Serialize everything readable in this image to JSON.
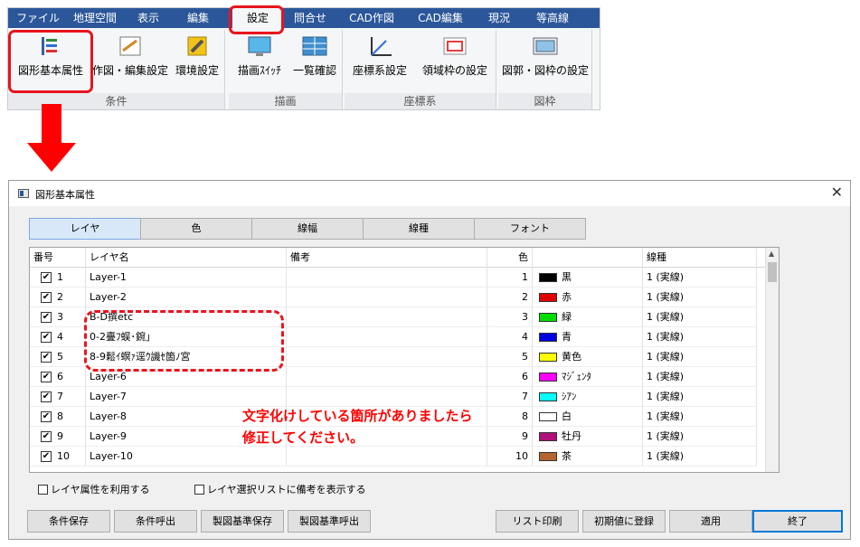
{
  "ribbon": {
    "menu": [
      "ファイル",
      "地理空間",
      "表示",
      "編集",
      "設定",
      "問合せ",
      "CAD作図",
      "CAD編集",
      "現況",
      "等高線"
    ],
    "groups": [
      {
        "label": "条件",
        "buttons": [
          "図形基本属性",
          "作図・編集設定",
          "環境設定"
        ]
      },
      {
        "label": "描画",
        "buttons": [
          "描画ｽｲｯﾁ",
          "一覧確認"
        ]
      },
      {
        "label": "座標系",
        "buttons": [
          "座標系設定",
          "領域枠の設定"
        ]
      },
      {
        "label": "図枠",
        "buttons": [
          "図郭・図枠の設定"
        ]
      }
    ]
  },
  "dialog": {
    "title": "図形基本属性",
    "tabs": [
      "レイヤ",
      "色",
      "線幅",
      "線種",
      "フォント"
    ],
    "columns": [
      "番号",
      "レイヤ名",
      "備考",
      "色",
      "",
      "線種"
    ],
    "rows": [
      {
        "num": "1",
        "name": "Layer-1",
        "note": "",
        "color": "1",
        "color_name": "黒",
        "swatch": "#000000",
        "line": "1 (実線)"
      },
      {
        "num": "2",
        "name": "Layer-2",
        "note": "",
        "color": "2",
        "color_name": "赤",
        "swatch": "#e00000",
        "line": "1 (実線)"
      },
      {
        "num": "3",
        "name": "B-D撰etc",
        "note": "",
        "color": "3",
        "color_name": "緑",
        "swatch": "#00dd00",
        "line": "1 (実線)"
      },
      {
        "num": "4",
        "name": "0-2亹ﾌ蜈･鋺｣",
        "note": "",
        "color": "4",
        "color_name": "青",
        "swatch": "#0000e0",
        "line": "1 (実線)"
      },
      {
        "num": "5",
        "name": "8-9鬆ｲ螟ｧ逕ｳ譏ｾ箇ﾉ宮",
        "note": "",
        "color": "5",
        "color_name": "黄色",
        "swatch": "#ffff00",
        "line": "1 (実線)"
      },
      {
        "num": "6",
        "name": "Layer-6",
        "note": "",
        "color": "6",
        "color_name": "ﾏｼﾞｪﾝﾀ",
        "swatch": "#ff00ff",
        "line": "1 (実線)"
      },
      {
        "num": "7",
        "name": "Layer-7",
        "note": "",
        "color": "7",
        "color_name": "ｼｱﾝ",
        "swatch": "#00ffff",
        "line": "1 (実線)"
      },
      {
        "num": "8",
        "name": "Layer-8",
        "note": "",
        "color": "8",
        "color_name": "白",
        "swatch": "#ffffff",
        "line": "1 (実線)"
      },
      {
        "num": "9",
        "name": "Layer-9",
        "note": "",
        "color": "9",
        "color_name": "牡丹",
        "swatch": "#b0107a",
        "line": "1 (実線)"
      },
      {
        "num": "10",
        "name": "Layer-10",
        "note": "",
        "color": "10",
        "color_name": "茶",
        "swatch": "#b5662e",
        "line": "1 (実線)"
      }
    ],
    "options": [
      "レイヤ属性を利用する",
      "レイヤ選択リストに備考を表示する"
    ],
    "buttons": [
      "条件保存",
      "条件呼出",
      "製図基準保存",
      "製図基準呼出",
      "リスト印刷",
      "初期値に登録",
      "適用",
      "終了"
    ]
  },
  "annotation": {
    "line1": "文字化けしている箇所がありましたら",
    "line2": "修正してください。"
  },
  "colors": {
    "highlight": "#e8141e",
    "menubar": "#2b579a",
    "accent": "#ff0000"
  }
}
